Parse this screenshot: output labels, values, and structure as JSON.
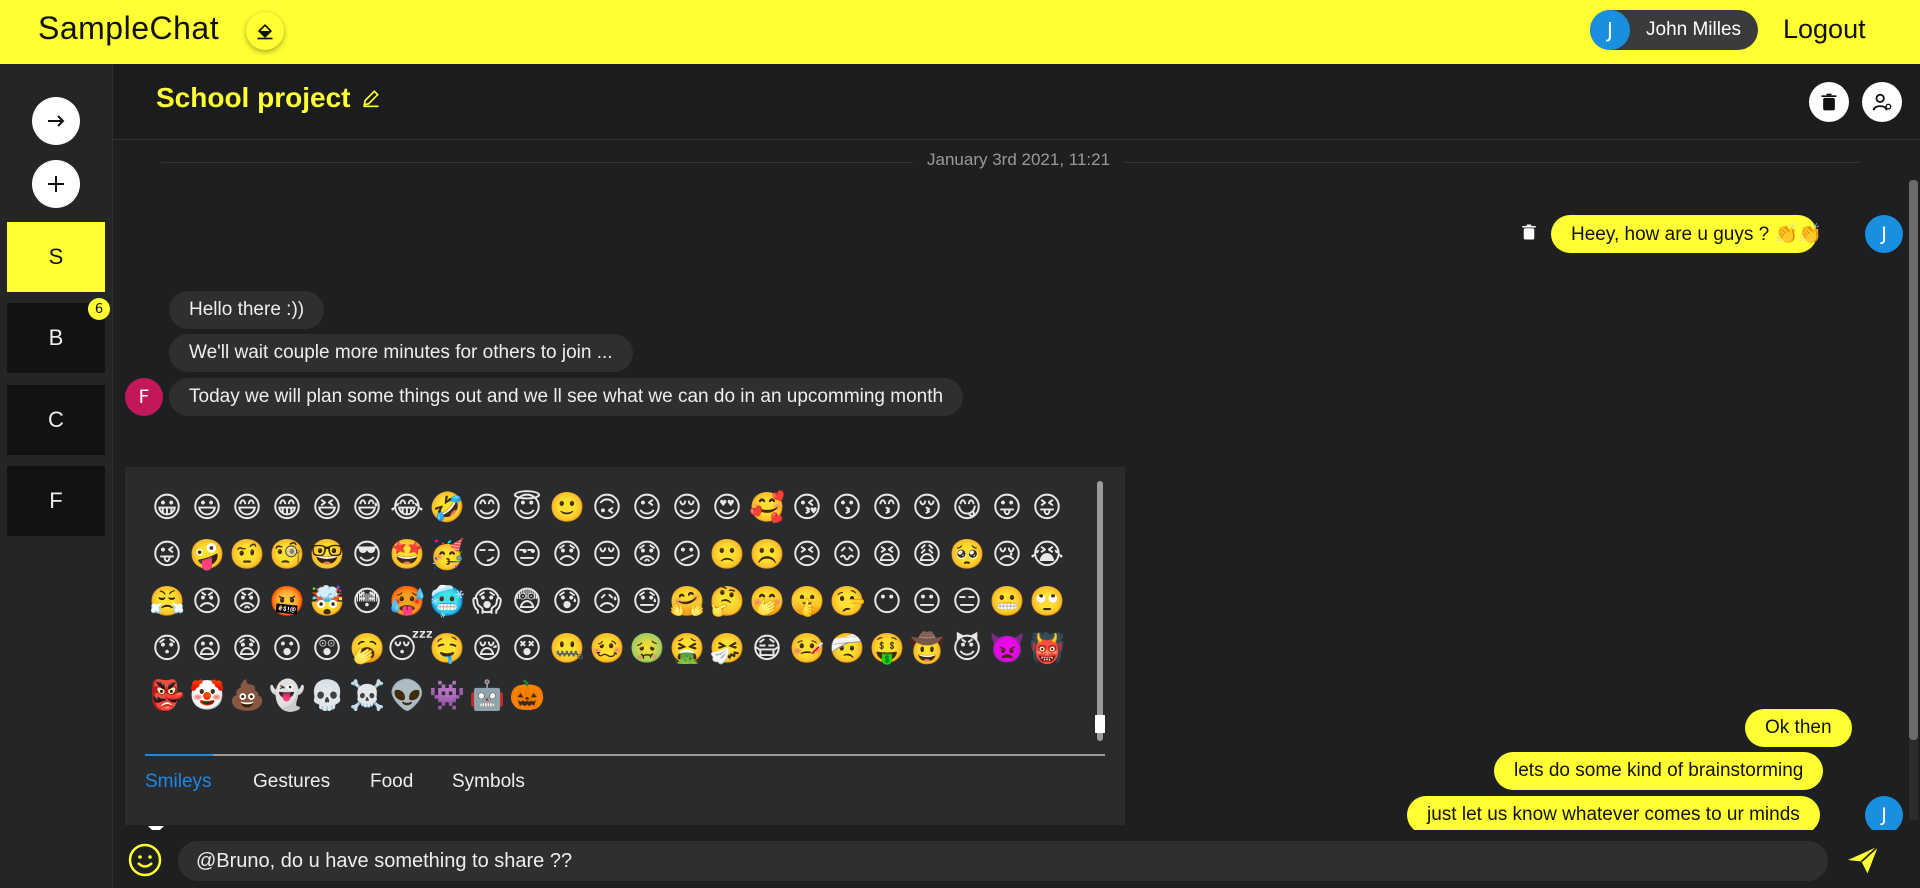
{
  "app": {
    "title": "SampleChat"
  },
  "user": {
    "initial": "J",
    "name": "John Milles",
    "logout_label": "Logout"
  },
  "sidebar": {
    "rooms": [
      {
        "label": "S",
        "active": true
      },
      {
        "label": "B",
        "badge": "6"
      },
      {
        "label": "C"
      },
      {
        "label": "F"
      }
    ]
  },
  "chat": {
    "title": "School project",
    "date_divider": "January 3rd 2021, 11:21",
    "messages": [
      {
        "from": "me",
        "text": "Heey, how are u guys ? 👏👏"
      },
      {
        "from": "F",
        "text": "Hello there :))"
      },
      {
        "from": "F",
        "text": "We'll wait couple more minutes for others to join ..."
      },
      {
        "from": "F",
        "text": "Today we will plan some things out and we ll see what we can do in an upcomming month"
      },
      {
        "from": "me",
        "text": "Ok then"
      },
      {
        "from": "me",
        "text": "lets do some kind of brainstorming"
      },
      {
        "from": "me",
        "text": "just let us know whatever comes to ur minds"
      }
    ],
    "sender_initial_other": "F",
    "sender_initial_me": "J"
  },
  "emoji_picker": {
    "emojis": [
      "😀",
      "😃",
      "😄",
      "😁",
      "😆",
      "😅",
      "😂",
      "🤣",
      "😊",
      "😇",
      "🙂",
      "🙃",
      "😉",
      "😌",
      "😍",
      "🥰",
      "😘",
      "😗",
      "😙",
      "😚",
      "😋",
      "😛",
      "😝",
      "😜",
      "🤪",
      "🤨",
      "🧐",
      "🤓",
      "😎",
      "🤩",
      "🥳",
      "😏",
      "😒",
      "😞",
      "😔",
      "😟",
      "😕",
      "🙁",
      "☹️",
      "😣",
      "😖",
      "😫",
      "😩",
      "🥺",
      "😢",
      "😭",
      "😤",
      "😠",
      "😡",
      "🤬",
      "🤯",
      "😳",
      "🥵",
      "🥶",
      "😱",
      "😨",
      "😰",
      "😥",
      "😓",
      "🤗",
      "🤔",
      "🤭",
      "🤫",
      "🤥",
      "😶",
      "😐",
      "😑",
      "😬",
      "🙄",
      "😯",
      "😦",
      "😧",
      "😮",
      "😲",
      "🥱",
      "😴",
      "🤤",
      "😪",
      "😵",
      "🤐",
      "🥴",
      "🤢",
      "🤮",
      "🤧",
      "😷",
      "🤒",
      "🤕",
      "🤑",
      "🤠",
      "😈",
      "👿",
      "👹",
      "👺",
      "🤡",
      "💩",
      "👻",
      "💀",
      "☠️",
      "👽",
      "👾",
      "🤖",
      "🎃"
    ],
    "tabs": [
      "Smileys",
      "Gestures",
      "Food",
      "Symbols"
    ],
    "active_tab": "Smileys"
  },
  "composer": {
    "value": "@Bruno, do u have something to share ??"
  },
  "colors": {
    "accent": "#ffff33",
    "background": "#1e1f21",
    "me_avatar": "#1a8fe0",
    "other_avatar": "#c2185b",
    "tab_active": "#1e88e5"
  }
}
